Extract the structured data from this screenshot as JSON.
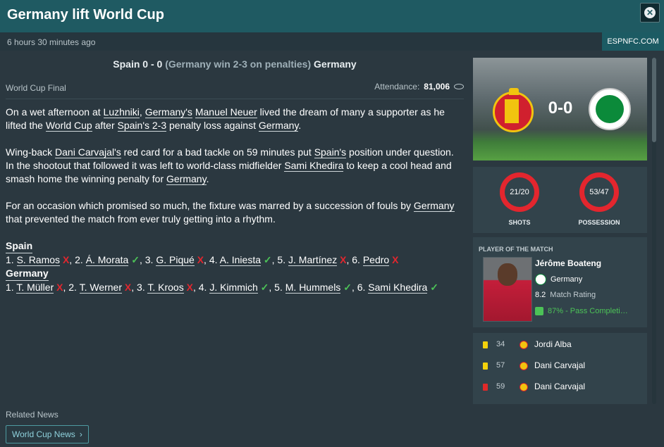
{
  "header": {
    "title": "Germany lift World Cup",
    "close_icon": "close-icon"
  },
  "subheader": {
    "timestamp": "6 hours 30 minutes ago",
    "source": "ESPNFC.COM"
  },
  "match": {
    "home": "Spain",
    "score": "0 - 0",
    "note": "(Germany win 2-3 on penalties)",
    "away": "Germany",
    "competition": "World Cup Final",
    "attendance_label": "Attendance:",
    "attendance_value": "81,006"
  },
  "article": {
    "p1": {
      "t1": "On a wet afternoon at ",
      "luzhniki": "Luzhniki",
      "t2": ", ",
      "germanys": "Germany's",
      "t3": " ",
      "neuer": "Manuel Neuer",
      "t4": " lived the dream of many a supporter as he lifted the ",
      "worldcup": "World Cup",
      "t5": " after ",
      "spains": "Spain's 2-3",
      "t6": " penalty loss against ",
      "germany": "Germany",
      "t7": "."
    },
    "p2": {
      "t1": "Wing-back ",
      "carvajal": "Dani Carvajal's",
      "t2": " red card for a bad tackle on 59 minutes put ",
      "spains": "Spain's",
      "t3": " position under question. In the shootout that followed it was left to world-class midfielder ",
      "khedira": "Sami Khedira",
      "t4": " to keep a cool head and smash home the winning penalty for ",
      "germany": "Germany",
      "t5": "."
    },
    "p3": {
      "t1": "For an occasion which promised so much, the fixture was marred by a succession of fouls by ",
      "germany": "Germany",
      "t2": " that prevented the match from ever truly getting into a rhythm."
    }
  },
  "penalties": {
    "spain_title": "Spain",
    "germany_title": "Germany",
    "miss_mark": "X",
    "score_mark": "✓",
    "spain": [
      {
        "num": "1.",
        "name": "S. Ramos"
      },
      {
        "num": "2.",
        "name": "Á. Morata"
      },
      {
        "num": "3.",
        "name": "G. Piqué"
      },
      {
        "num": "4.",
        "name": "A. Iniesta"
      },
      {
        "num": "5.",
        "name": "J. Martínez"
      },
      {
        "num": "6.",
        "name": "Pedro"
      }
    ],
    "germany": [
      {
        "num": "1.",
        "name": "T. Müller"
      },
      {
        "num": "2.",
        "name": "T. Werner"
      },
      {
        "num": "3.",
        "name": "T. Kroos"
      },
      {
        "num": "4.",
        "name": "J. Kimmich"
      },
      {
        "num": "5.",
        "name": "M. Hummels"
      },
      {
        "num": "6.",
        "name": "Sami Khedira"
      }
    ]
  },
  "related": {
    "label": "Related News",
    "button": "World Cup News",
    "button_icon": "chevron-right-icon"
  },
  "scoreboard": {
    "score": "0-0"
  },
  "stats": {
    "shots_value": "21/20",
    "shots_label": "SHOTS",
    "possession_value": "53/47",
    "possession_label": "POSSESSION"
  },
  "potm": {
    "title": "PLAYER OF THE MATCH",
    "name": "Jérôme Boateng",
    "club": "Germany",
    "rating_value": "8.2",
    "rating_label": "Match Rating",
    "pass_text": "87% - Pass Completi…"
  },
  "events": [
    {
      "card": "yellow",
      "minute": "34",
      "player": "Jordi Alba"
    },
    {
      "card": "yellow",
      "minute": "57",
      "player": "Dani Carvajal"
    },
    {
      "card": "red",
      "minute": "59",
      "player": "Dani Carvajal"
    }
  ],
  "colors": {
    "header_bg": "#1f5a62",
    "panel_bg": "#32434b",
    "page_bg": "#2b3840",
    "miss": "#e2262e",
    "score": "#4cc257",
    "ring": "#e3262e"
  }
}
